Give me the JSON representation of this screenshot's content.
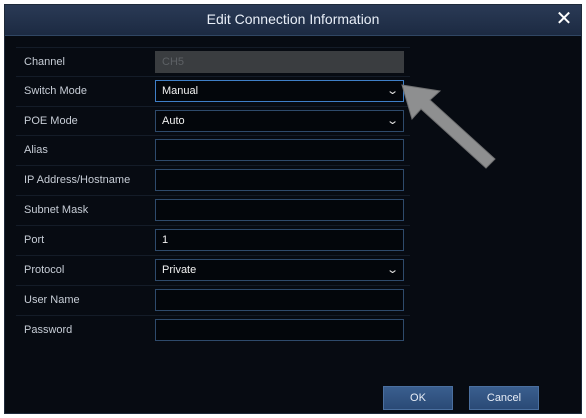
{
  "dialog": {
    "title": "Edit Connection Information",
    "close_glyph": "✕"
  },
  "form": {
    "channel": {
      "label": "Channel",
      "value": "CH5"
    },
    "switch_mode": {
      "label": "Switch Mode",
      "value": "Manual"
    },
    "poe_mode": {
      "label": "POE Mode",
      "value": "Auto"
    },
    "alias": {
      "label": "Alias",
      "value": ""
    },
    "ip_address": {
      "label": "IP Address/Hostname",
      "value": ""
    },
    "subnet_mask": {
      "label": "Subnet Mask",
      "value": ""
    },
    "port": {
      "label": "Port",
      "value": "1"
    },
    "protocol": {
      "label": "Protocol",
      "value": "Private"
    },
    "user_name": {
      "label": "User Name",
      "value": ""
    },
    "password": {
      "label": "Password",
      "value": ""
    }
  },
  "buttons": {
    "ok": "OK",
    "cancel": "Cancel"
  },
  "icons": {
    "close": "close-icon",
    "dropdown": "chevron-down-icon",
    "annotation": "arrow-pointer-icon"
  },
  "colors": {
    "background": "#070b12",
    "titlebar": "#1c2a42",
    "field_border": "#2e4a6b",
    "button": "#2a4a76"
  }
}
